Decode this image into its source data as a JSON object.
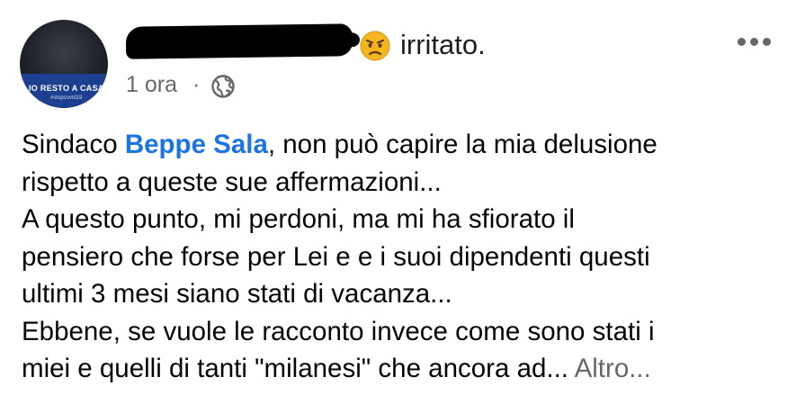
{
  "header": {
    "avatar": {
      "overlay_text": "IO RESTO A CASA",
      "overlay_subtext": "#stopcovid19",
      "icon": "profile-avatar"
    },
    "feeling": {
      "emoji": "angry-face-icon",
      "text": "irritato."
    },
    "timestamp": "1 ora",
    "separator": "·",
    "privacy_icon": "globe-icon",
    "menu_icon": "more-options-icon"
  },
  "post": {
    "line1_prefix": "Sindaco ",
    "mention": "Beppe Sala",
    "line1_suffix": ", non può capire la mia delusione",
    "line2": "rispetto a queste sue affermazioni...",
    "line3": "A questo punto, mi perdoni, ma mi ha sfiorato il",
    "line4": "pensiero che forse per Lei e e i suoi dipendenti questi",
    "line5": "ultimi 3 mesi siano stati di vacanza...",
    "line6": "Ebbene, se vuole le racconto invece come sono stati i",
    "line7": "miei e quelli di tanti \"milanesi\" che ancora ad...",
    "more_label": "Altro..."
  },
  "colors": {
    "mention": "#1b74e4",
    "secondary_text": "#65676b",
    "primary_text": "#050505",
    "redaction": "#000000"
  }
}
